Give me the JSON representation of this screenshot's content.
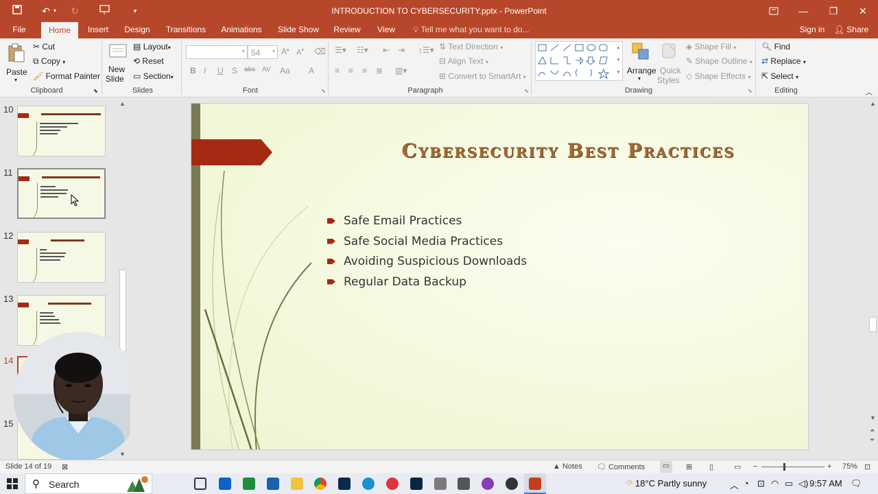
{
  "window": {
    "title": "INTRODUCTION TO CYBERSECURITY.pptx - PowerPoint",
    "minimize": "—",
    "restore": "❐",
    "close": "✕"
  },
  "tabs": [
    "File",
    "Home",
    "Insert",
    "Design",
    "Transitions",
    "Animations",
    "Slide Show",
    "Review",
    "View"
  ],
  "active_tab": "Home",
  "tell_me": "Tell me what you want to do...",
  "sign_in": "Sign in",
  "share": "Share",
  "ribbon": {
    "clipboard": {
      "paste": "Paste",
      "cut": "Cut",
      "copy": "Copy",
      "format_painter": "Format Painter",
      "label": "Clipboard"
    },
    "slides": {
      "new_slide_1": "New",
      "new_slide_2": "Slide",
      "layout": "Layout",
      "reset": "Reset",
      "section": "Section",
      "label": "Slides"
    },
    "font": {
      "size": "54",
      "label": "Font",
      "bold": "B",
      "italic": "I",
      "underline": "U",
      "shadow": "S",
      "strike": "abc",
      "spacing": "AV",
      "case": "Aa",
      "color": "A"
    },
    "paragraph": {
      "text_direction": "Text Direction",
      "align_text": "Align Text",
      "convert_smartart": "Convert to SmartArt",
      "label": "Paragraph"
    },
    "drawing": {
      "arrange": "Arrange",
      "quick_styles_1": "Quick",
      "quick_styles_2": "Styles",
      "shape_fill": "Shape Fill",
      "shape_outline": "Shape Outline",
      "shape_effects": "Shape Effects",
      "label": "Drawing"
    },
    "editing": {
      "find": "Find",
      "replace": "Replace",
      "select": "Select",
      "label": "Editing"
    }
  },
  "thumbnails": [
    {
      "num": "10",
      "lines": 4
    },
    {
      "num": "11",
      "lines": 4
    },
    {
      "num": "12",
      "lines": 4
    },
    {
      "num": "13",
      "lines": 4
    },
    {
      "num": "14"
    },
    {
      "num": "15"
    }
  ],
  "slide": {
    "title": "Cybersecurity Best Practices",
    "bullets": [
      "Safe Email Practices",
      "Safe Social Media Practices",
      "Avoiding Suspicious Downloads",
      "Regular Data Backup"
    ]
  },
  "status": {
    "slide_of": "Slide 14 of 19",
    "notes": "Notes",
    "comments": "Comments",
    "zoom": "75%",
    "zoom_minus": "−",
    "zoom_plus": "+"
  },
  "taskbar": {
    "search": "Search",
    "weather": "18°C  Partly sunny",
    "time": "9:57 AM"
  },
  "colors": {
    "accent": "#b7472a",
    "slide_title": "#a06a36",
    "bullet": "#a52a14"
  }
}
